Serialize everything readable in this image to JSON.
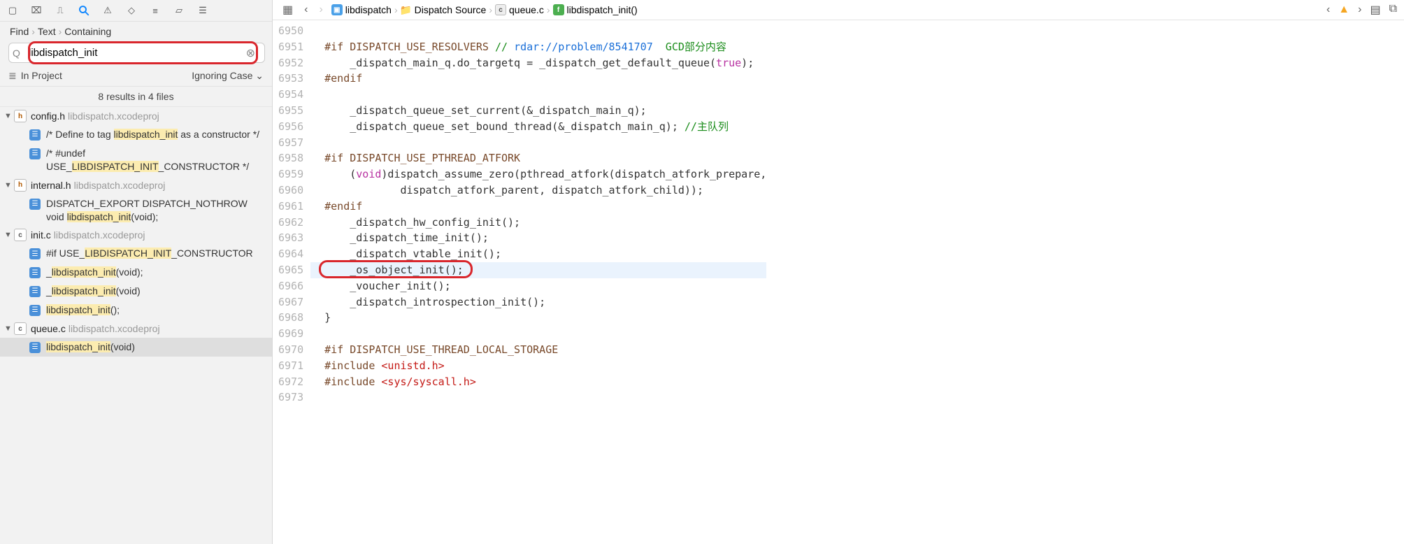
{
  "sidebar": {
    "breadcrumb": [
      "Find",
      "Text",
      "Containing"
    ],
    "search_value": "libdispatch_init",
    "scope_label": "In Project",
    "ignoring_label": "Ignoring Case",
    "results_summary": "8 results in 4 files",
    "files": [
      {
        "icon": "h",
        "name": "config.h",
        "proj": "libdispatch.xcodeproj",
        "matches": [
          {
            "pre": "/* Define to tag ",
            "hl": "libdispatch_init",
            "post": " as a constructor */"
          },
          {
            "pre": "/* #undef USE_",
            "hl": "LIBDISPATCH_INIT",
            "post": "_CONSTRUCTOR */"
          }
        ]
      },
      {
        "icon": "h",
        "name": "internal.h",
        "proj": "libdispatch.xcodeproj",
        "matches": [
          {
            "pre": "DISPATCH_EXPORT DISPATCH_NOTHROW void ",
            "hl": "libdispatch_init",
            "post": "(void);"
          }
        ]
      },
      {
        "icon": "c",
        "name": "init.c",
        "proj": "libdispatch.xcodeproj",
        "matches": [
          {
            "pre": "#if USE_",
            "hl": "LIBDISPATCH_INIT",
            "post": "_CONSTRUCTOR"
          },
          {
            "pre": "_",
            "hl": "libdispatch_init",
            "post": "(void);"
          },
          {
            "pre": "_",
            "hl": "libdispatch_init",
            "post": "(void)"
          },
          {
            "pre": "",
            "hl": "libdispatch_init",
            "post": "();"
          }
        ]
      },
      {
        "icon": "c",
        "name": "queue.c",
        "proj": "libdispatch.xcodeproj",
        "matches": [
          {
            "pre": "",
            "hl": "libdispatch_init",
            "post": "(void)",
            "selected": true
          }
        ]
      }
    ]
  },
  "editor": {
    "crumbs": [
      "libdispatch",
      "Dispatch Source",
      "queue.c",
      "libdispatch_init()"
    ],
    "lines": [
      {
        "n": 6950,
        "t": ""
      },
      {
        "n": 6951,
        "seg": [
          {
            "c": "pp",
            "t": "#if DISPATCH_USE_RESOLVERS "
          },
          {
            "c": "cm",
            "t": "// "
          },
          {
            "c": "url",
            "t": "rdar://problem/8541707"
          },
          {
            "c": "cm",
            "t": "  GCD部分内容"
          }
        ]
      },
      {
        "n": 6952,
        "seg": [
          {
            "t": "    _dispatch_main_q.do_targetq = _dispatch_get_default_queue("
          },
          {
            "c": "bool",
            "t": "true"
          },
          {
            "t": ");"
          }
        ]
      },
      {
        "n": 6953,
        "seg": [
          {
            "c": "pp",
            "t": "#endif"
          }
        ]
      },
      {
        "n": 6954,
        "t": ""
      },
      {
        "n": 6955,
        "t": "    _dispatch_queue_set_current(&_dispatch_main_q);"
      },
      {
        "n": 6956,
        "seg": [
          {
            "t": "    _dispatch_queue_set_bound_thread(&_dispatch_main_q); "
          },
          {
            "c": "cm",
            "t": "//主队列"
          }
        ]
      },
      {
        "n": 6957,
        "t": ""
      },
      {
        "n": 6958,
        "seg": [
          {
            "c": "pp",
            "t": "#if DISPATCH_USE_PTHREAD_ATFORK"
          }
        ]
      },
      {
        "n": 6959,
        "seg": [
          {
            "t": "    ("
          },
          {
            "c": "kw",
            "t": "void"
          },
          {
            "t": ")dispatch_assume_zero(pthread_atfork(dispatch_atfork_prepare,"
          }
        ]
      },
      {
        "n": 6960,
        "t": "            dispatch_atfork_parent, dispatch_atfork_child));"
      },
      {
        "n": 6961,
        "seg": [
          {
            "c": "pp",
            "t": "#endif"
          }
        ]
      },
      {
        "n": 6962,
        "t": "    _dispatch_hw_config_init();"
      },
      {
        "n": 6963,
        "t": "    _dispatch_time_init();"
      },
      {
        "n": 6964,
        "t": "    _dispatch_vtable_init();"
      },
      {
        "n": 6965,
        "t": "    _os_object_init();",
        "cur": true,
        "box": true
      },
      {
        "n": 6966,
        "t": "    _voucher_init();"
      },
      {
        "n": 6967,
        "t": "    _dispatch_introspection_init();"
      },
      {
        "n": 6968,
        "t": "}"
      },
      {
        "n": 6969,
        "t": ""
      },
      {
        "n": 6970,
        "seg": [
          {
            "c": "pp",
            "t": "#if DISPATCH_USE_THREAD_LOCAL_STORAGE"
          }
        ]
      },
      {
        "n": 6971,
        "seg": [
          {
            "c": "pp",
            "t": "#include "
          },
          {
            "c": "str",
            "t": "<unistd.h>"
          }
        ]
      },
      {
        "n": 6972,
        "seg": [
          {
            "c": "pp",
            "t": "#include "
          },
          {
            "c": "str",
            "t": "<sys/syscall.h>"
          }
        ]
      },
      {
        "n": 6973,
        "t": ""
      }
    ]
  }
}
